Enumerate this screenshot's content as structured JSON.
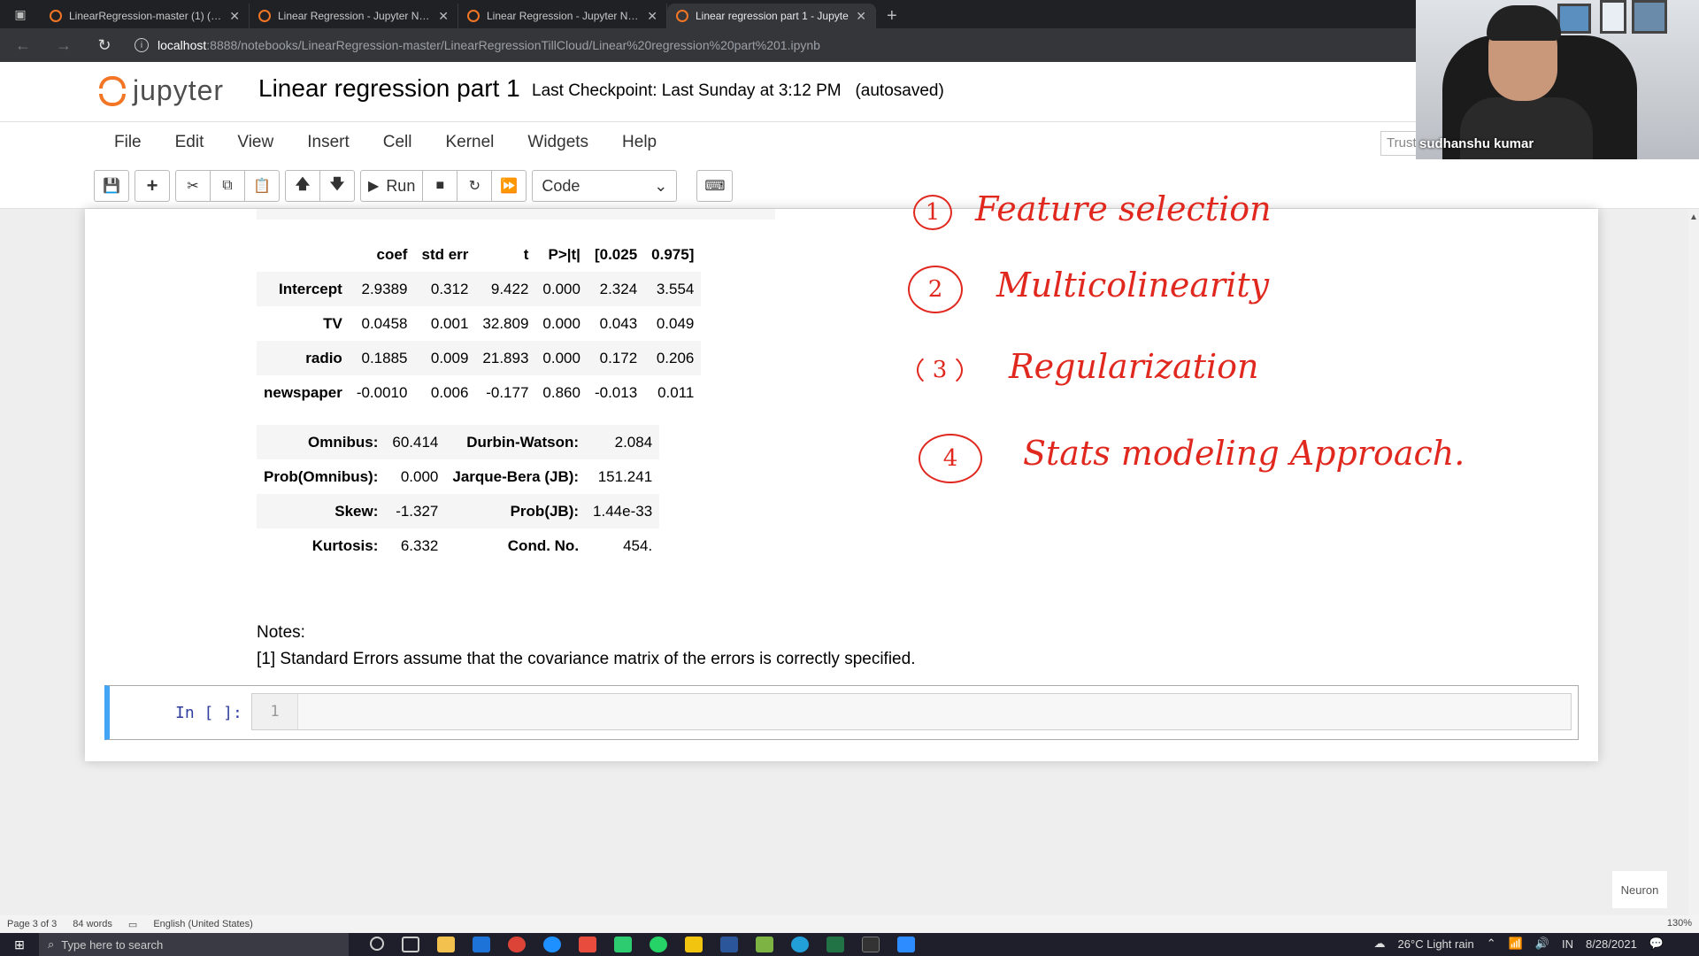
{
  "browser": {
    "tabs": [
      {
        "label": "LinearRegression-master (1) (4)/",
        "active": false
      },
      {
        "label": "Linear Regression - Jupyter Note",
        "active": false
      },
      {
        "label": "Linear Regression - Jupyter Note",
        "active": false
      },
      {
        "label": "Linear regression part 1 - Jupyte",
        "active": true
      }
    ],
    "url_host": "localhost",
    "url_rest": ":8888/notebooks/LinearRegression-master/LinearRegressionTillCloud/Linear%20regression%20part%201.ipynb"
  },
  "jupyter": {
    "logo_text": "jupyter",
    "notebook_title": "Linear regression part 1",
    "checkpoint": "Last Checkpoint: Last Sunday at 3:12 PM",
    "autosave": "(autosaved)",
    "menu": [
      "File",
      "Edit",
      "View",
      "Insert",
      "Cell",
      "Kernel",
      "Widgets",
      "Help"
    ],
    "trusted": "Trusted",
    "toolbar": {
      "run_label": "Run",
      "cell_type": "Code"
    }
  },
  "coef_table": {
    "headers": [
      "",
      "coef",
      "std err",
      "t",
      "P>|t|",
      "[0.025",
      "0.975]"
    ],
    "rows": [
      [
        "Intercept",
        "2.9389",
        "0.312",
        "9.422",
        "0.000",
        "2.324",
        "3.554"
      ],
      [
        "TV",
        "0.0458",
        "0.001",
        "32.809",
        "0.000",
        "0.043",
        "0.049"
      ],
      [
        "radio",
        "0.1885",
        "0.009",
        "21.893",
        "0.000",
        "0.172",
        "0.206"
      ],
      [
        "newspaper",
        "-0.0010",
        "0.006",
        "-0.177",
        "0.860",
        "-0.013",
        "0.011"
      ]
    ]
  },
  "diag_table": {
    "rows": [
      [
        "Omnibus:",
        "60.414",
        "Durbin-Watson:",
        "2.084"
      ],
      [
        "Prob(Omnibus):",
        "0.000",
        "Jarque-Bera (JB):",
        "151.241"
      ],
      [
        "Skew:",
        "-1.327",
        "Prob(JB):",
        "1.44e-33"
      ],
      [
        "Kurtosis:",
        "6.332",
        "Cond. No.",
        "454."
      ]
    ]
  },
  "notes": {
    "title": "Notes:",
    "line1": "[1] Standard Errors assume that the covariance matrix of the errors is correctly specified."
  },
  "input_cell": {
    "prompt": "In [ ]:",
    "line_number": "1"
  },
  "annotations": [
    {
      "num": "1",
      "text": "Feature selection"
    },
    {
      "num": "2",
      "text": "Multicolinearity"
    },
    {
      "num": "3",
      "text": "Regularization"
    },
    {
      "num": "4",
      "text": "Stats modeling Approach."
    }
  ],
  "webcam": {
    "name": "sudhanshu kumar"
  },
  "word_status": {
    "page": "Page 3 of 3",
    "words": "84 words",
    "language": "English (United States)",
    "zoom": "130%"
  },
  "watermark": "Neuron",
  "taskbar": {
    "search_placeholder": "Type here to search",
    "weather": "26°C  Light rain",
    "lang": "IN",
    "date": "8/28/2021"
  }
}
